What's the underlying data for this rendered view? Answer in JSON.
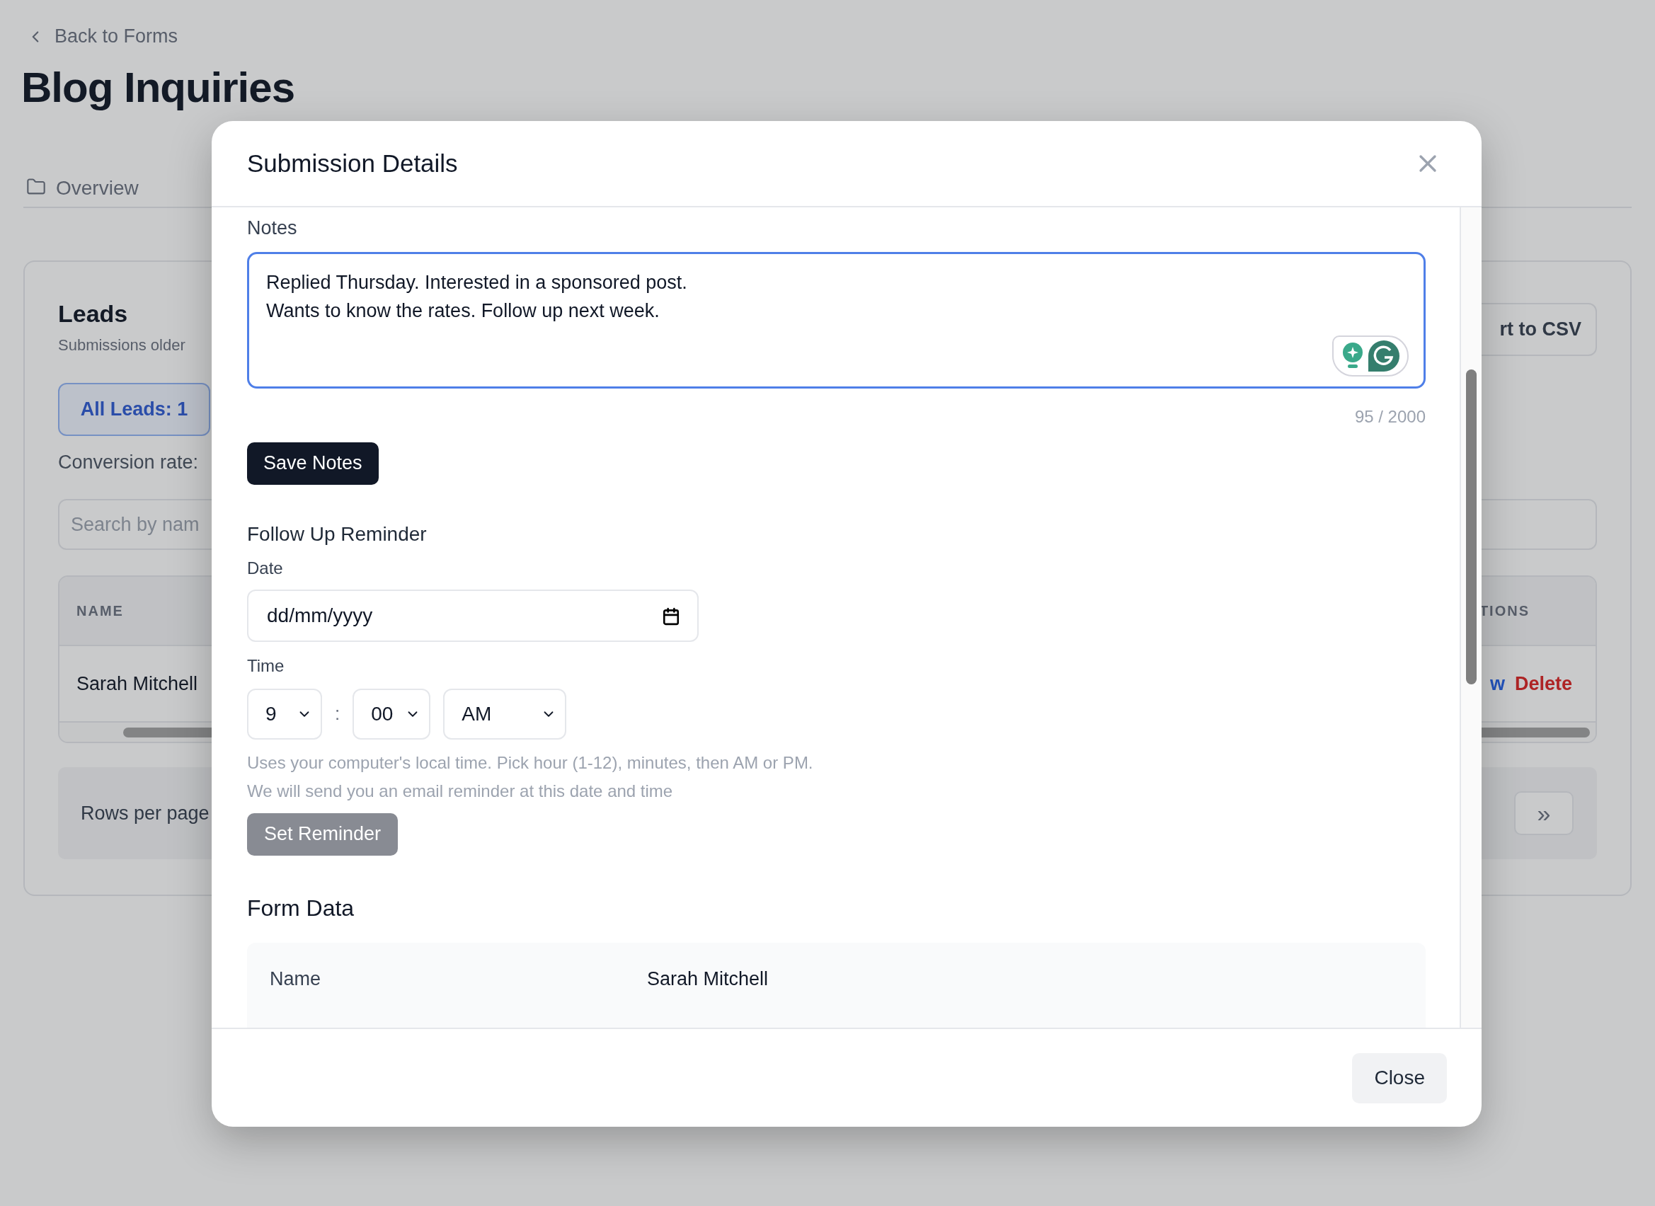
{
  "background": {
    "back_link": "Back to Forms",
    "title": "Blog Inquiries",
    "tabs": [
      {
        "label": "Overview",
        "selected": false
      }
    ],
    "leads": {
      "title": "Leads",
      "subtitle": "Submissions older",
      "export_button": "rt to CSV",
      "filters": [
        {
          "label": "All Leads: 1",
          "selected": true
        }
      ],
      "conversion": "Conversion rate:",
      "search": {
        "placeholder": "Search by nam"
      },
      "table": {
        "columns": [
          "NAME",
          "TIONS"
        ],
        "rows": [
          {
            "name": "Sarah Mitchell",
            "actions": [
              {
                "kind": "view",
                "label": "w"
              },
              {
                "kind": "delete",
                "label": "Delete"
              }
            ]
          }
        ]
      },
      "footer": {
        "rows_label": "Rows per page",
        "last_page": "»"
      }
    }
  },
  "modal": {
    "title": "Submission Details",
    "notes": {
      "label": "Notes",
      "value": "Replied Thursday. Interested in a sponsored post.\nWants to know the rates. Follow up next week.",
      "focused": true,
      "counter": "95 / 2000",
      "save_button": "Save Notes"
    },
    "reminder": {
      "title": "Follow Up Reminder",
      "date_label": "Date",
      "date_placeholder": "dd/mm/yyyy",
      "time_label": "Time",
      "hour": "9",
      "separator": ":",
      "minute": "00",
      "period": "AM",
      "help": [
        "Uses your computer's local time. Pick hour (1-12), minutes, then AM or PM.",
        "We will send you an email reminder at this date and time"
      ],
      "set_button": {
        "label": "Set Reminder",
        "disabled": true
      }
    },
    "form_data": {
      "title": "Form Data",
      "rows": [
        {
          "label": "Name",
          "value": "Sarah Mitchell"
        }
      ]
    },
    "close_button": "Close"
  }
}
